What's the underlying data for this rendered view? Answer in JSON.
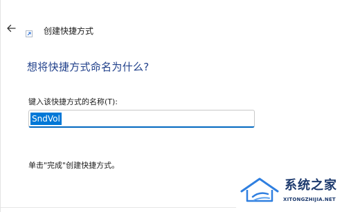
{
  "header": {
    "back_icon": "arrow-left-icon",
    "wizard_icon": "shortcut-icon",
    "title": "创建快捷方式"
  },
  "main": {
    "question": "想将快捷方式命名为什么?",
    "field_label": "键入该快捷方式的名称(T):",
    "name_value": "SndVol",
    "hint": "单击\"完成\"创建快捷方式。"
  },
  "watermark": {
    "brand": "系统之家",
    "url": "XITONGZHIJIA.NET"
  },
  "colors": {
    "question_text": "#1f3f8a",
    "selection": "#0078d7",
    "input_underline": "#0067c0",
    "watermark": "#1d3a6e"
  }
}
